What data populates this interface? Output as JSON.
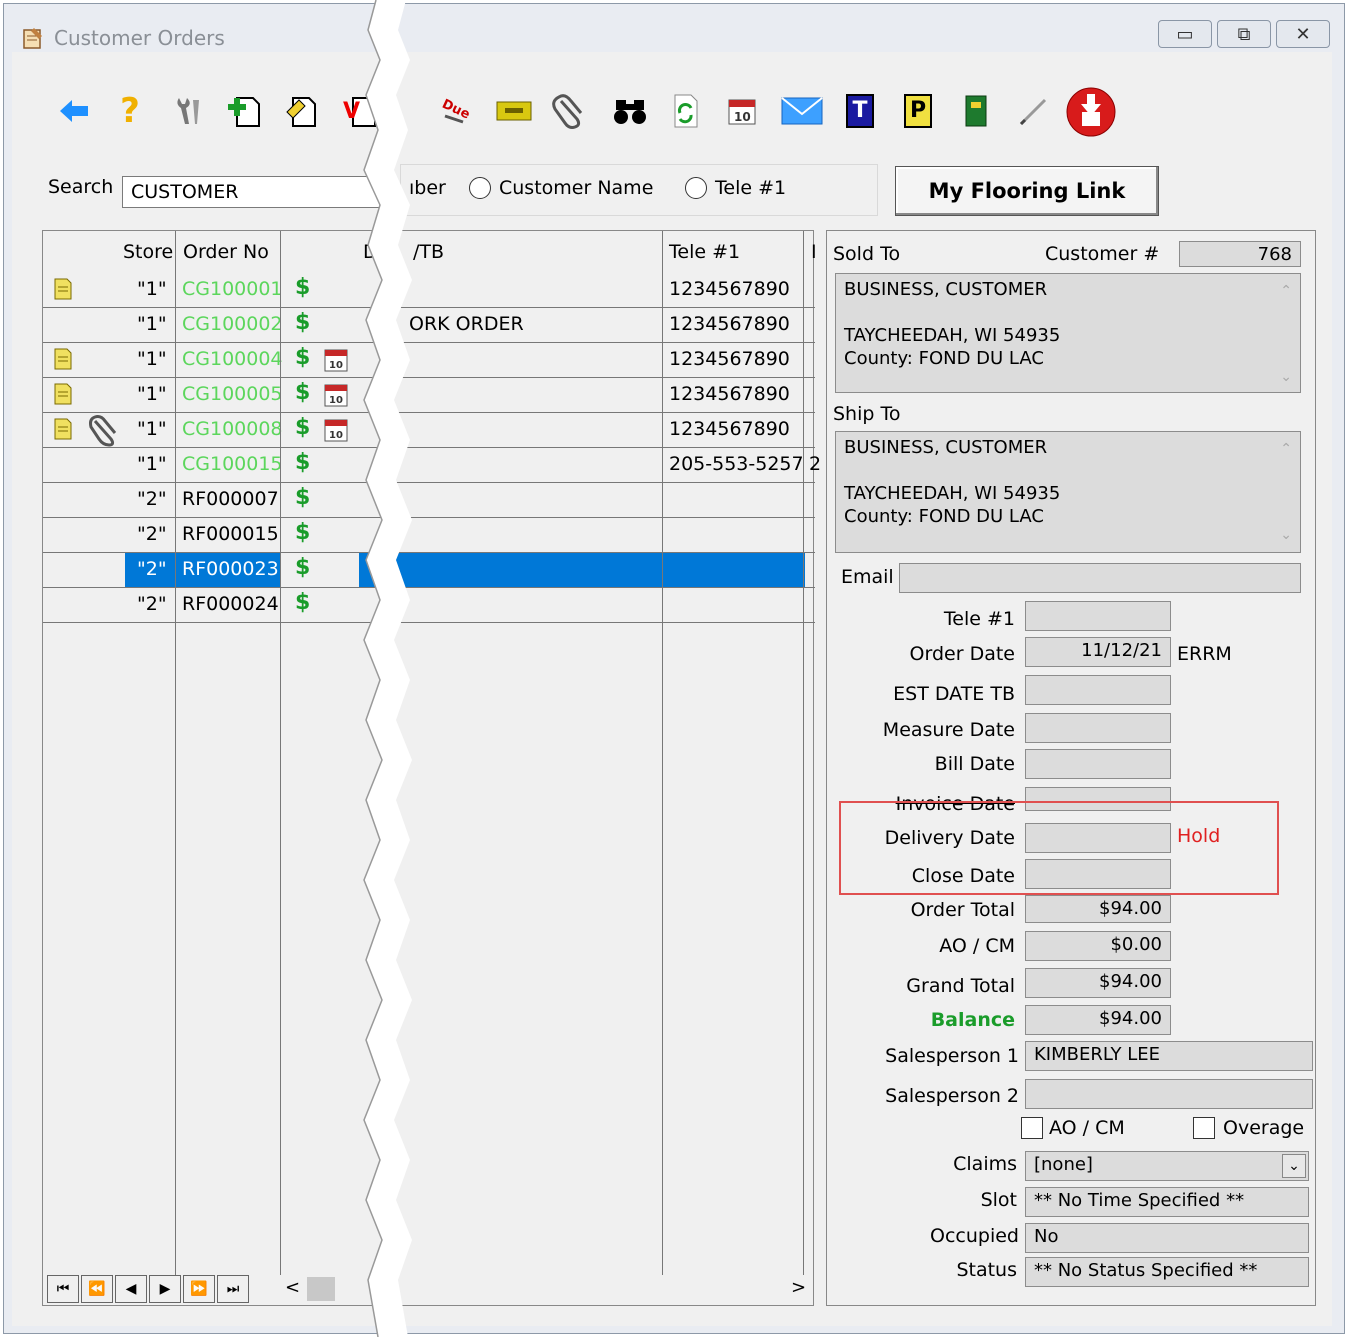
{
  "window": {
    "title": "Customer Orders",
    "minimize": "▭",
    "restore": "⧉",
    "close": "✕"
  },
  "toolbar": {
    "icons": [
      "back-arrow-icon",
      "help-icon",
      "tools-icon",
      "new-order-icon",
      "edit-order-icon",
      "void-icon",
      "due-icon",
      "ticket-icon",
      "attachment-icon",
      "binoculars-icon",
      "refresh-icon",
      "calendar-icon",
      "email-icon",
      "t-icon",
      "p-icon",
      "book-icon",
      "pen-icon",
      "download-icon"
    ],
    "due_label": "Due",
    "t_label": "T",
    "p_label": "P",
    "calendar_label": "10"
  },
  "search": {
    "label": "Search",
    "value": "CUSTOMER",
    "options": [
      "ıber",
      "Customer Name",
      "Tele #1"
    ]
  },
  "link_button": "My Flooring Link",
  "grid": {
    "headers": {
      "store": "Store",
      "order_no": "Order No",
      "d": "D",
      "tb": "/TB",
      "tele": "Tele #1",
      "i": "I"
    },
    "rows": [
      {
        "note": true,
        "clip": false,
        "store": "\"1\"",
        "order": "CG100001",
        "green": true,
        "cal": false,
        "work": "",
        "tele": "1234567890",
        "extra": ""
      },
      {
        "note": false,
        "clip": false,
        "store": "\"1\"",
        "order": "CG100002",
        "green": true,
        "cal": false,
        "work": "ORK ORDER",
        "tele": "1234567890",
        "extra": ""
      },
      {
        "note": true,
        "clip": false,
        "store": "\"1\"",
        "order": "CG100004",
        "green": true,
        "cal": true,
        "work": "",
        "tele": "1234567890",
        "extra": ""
      },
      {
        "note": true,
        "clip": false,
        "store": "\"1\"",
        "order": "CG100005",
        "green": true,
        "cal": true,
        "work": "",
        "tele": "1234567890",
        "extra": ""
      },
      {
        "note": true,
        "clip": true,
        "store": "\"1\"",
        "order": "CG100008",
        "green": true,
        "cal": true,
        "work": "",
        "tele": "1234567890",
        "extra": ""
      },
      {
        "note": false,
        "clip": false,
        "store": "\"1\"",
        "order": "CG100015",
        "green": true,
        "cal": false,
        "work": "",
        "tele": "205-553-5257",
        "extra": "2"
      },
      {
        "note": false,
        "clip": false,
        "store": "\"2\"",
        "order": "RF000007",
        "green": false,
        "cal": false,
        "work": "",
        "tele": "",
        "extra": ""
      },
      {
        "note": false,
        "clip": false,
        "store": "\"2\"",
        "order": "RF000015",
        "green": false,
        "cal": false,
        "work": "",
        "tele": "",
        "extra": ""
      },
      {
        "note": false,
        "clip": false,
        "store": "\"2\"",
        "order": "RF000023",
        "green": false,
        "cal": false,
        "work": "",
        "tele": "",
        "extra": "",
        "selected": true
      },
      {
        "note": false,
        "clip": false,
        "store": "\"2\"",
        "order": "RF000024",
        "green": false,
        "cal": false,
        "work": "",
        "tele": "",
        "extra": ""
      }
    ],
    "dollar": "$",
    "nav": [
      "⏮",
      "⏪",
      "◀",
      "▶",
      "⏩",
      "⏭"
    ],
    "scroll_left": "<",
    "scroll_right": ">"
  },
  "detail": {
    "sold_to_label": "Sold To",
    "customer_no_label": "Customer #",
    "customer_no": "768",
    "sold_to": [
      "BUSINESS, CUSTOMER",
      "",
      "TAYCHEEDAH, WI  54935",
      "County: FOND DU LAC"
    ],
    "ship_to_label": "Ship To",
    "ship_to": [
      "BUSINESS, CUSTOMER",
      "",
      "TAYCHEEDAH, WI  54935",
      "County: FOND DU LAC"
    ],
    "email_label": "Email",
    "email": "",
    "fields": {
      "tele": {
        "label": "Tele #1",
        "value": ""
      },
      "order_date": {
        "label": "Order Date",
        "value": "11/12/21",
        "note": "ERRM"
      },
      "est_date": {
        "label": "EST DATE TB",
        "value": ""
      },
      "measure_date": {
        "label": "Measure Date",
        "value": ""
      },
      "bill_date": {
        "label": "Bill Date",
        "value": ""
      },
      "invoice_date": {
        "label": "Invoice Date",
        "value": ""
      },
      "delivery_date": {
        "label": "Delivery Date",
        "value": "",
        "note": "Hold"
      },
      "close_date": {
        "label": "Close Date",
        "value": ""
      },
      "order_total": {
        "label": "Order Total",
        "value": "$94.00"
      },
      "ao_cm": {
        "label": "AO / CM",
        "value": "$0.00"
      },
      "grand_total": {
        "label": "Grand Total",
        "value": "$94.00"
      },
      "balance": {
        "label": "Balance",
        "value": "$94.00"
      },
      "salesperson1": {
        "label": "Salesperson 1",
        "value": "KIMBERLY LEE"
      },
      "salesperson2": {
        "label": "Salesperson 2",
        "value": ""
      },
      "claims": {
        "label": "Claims",
        "value": "[none]"
      },
      "slot": {
        "label": "Slot",
        "value": "** No Time Specified **"
      },
      "occupied": {
        "label": "Occupied",
        "value": "No"
      },
      "status": {
        "label": "Status",
        "value": "** No Status Specified **"
      }
    },
    "checks": {
      "ao_cm": "AO / CM",
      "overage": "Overage"
    }
  },
  "colors": {
    "selection": "#0078d7",
    "green_order": "#5cd65c",
    "dollar": "#1a9c2a",
    "balance": "#1a9c2a",
    "hold": "#e02020",
    "highlight_box": "#e05050"
  }
}
